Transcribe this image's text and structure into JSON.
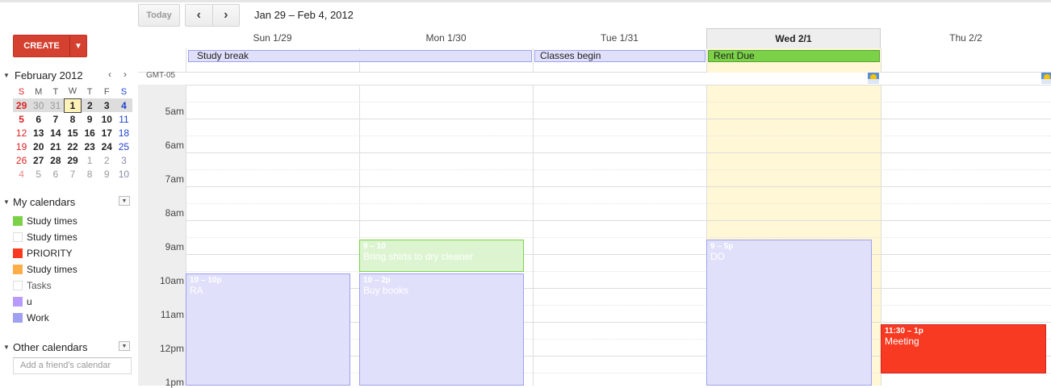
{
  "toolbar": {
    "today_label": "Today",
    "prev_icon": "‹",
    "next_icon": "›",
    "date_range": "Jan 29 – Feb 4, 2012"
  },
  "sidebar": {
    "create_label": "CREATE",
    "create_menu_icon": "▼",
    "mini_cal": {
      "title": "February 2012",
      "weekdays": [
        "S",
        "M",
        "T",
        "W",
        "T",
        "F",
        "S"
      ],
      "weeks": [
        [
          "29",
          "30",
          "31",
          "1",
          "2",
          "3",
          "4"
        ],
        [
          "5",
          "6",
          "7",
          "8",
          "9",
          "10",
          "11"
        ],
        [
          "12",
          "13",
          "14",
          "15",
          "16",
          "17",
          "18"
        ],
        [
          "19",
          "20",
          "21",
          "22",
          "23",
          "24",
          "25"
        ],
        [
          "26",
          "27",
          "28",
          "29",
          "1",
          "2",
          "3"
        ],
        [
          "4",
          "5",
          "6",
          "7",
          "8",
          "9",
          "10"
        ]
      ]
    },
    "my_calendars": {
      "title": "My calendars",
      "items": [
        {
          "label": "Study times",
          "color": "#7bd148"
        },
        {
          "label": "Study times",
          "color": "#ffffff"
        },
        {
          "label": "PRIORITY",
          "color": "#f83a22"
        },
        {
          "label": "Study times",
          "color": "#ffad46"
        },
        {
          "label": "Tasks",
          "color": "#ffffff"
        },
        {
          "label": "u",
          "color": "#b99aff"
        },
        {
          "label": "Work",
          "color": "#9fa0f0"
        }
      ]
    },
    "other_calendars": {
      "title": "Other calendars",
      "friend_placeholder": "Add a friend's calendar"
    }
  },
  "week": {
    "timezone": "GMT-05",
    "days": [
      "Sun 1/29",
      "Mon 1/30",
      "Tue 1/31",
      "Wed 2/1",
      "Thu 2/2"
    ],
    "hours": [
      "5am",
      "6am",
      "7am",
      "8am",
      "9am",
      "10am",
      "11am",
      "12pm",
      "1pm"
    ],
    "allday_events": [
      {
        "title": "Study break",
        "color": "#e0e0fa"
      },
      {
        "title": "Classes begin",
        "color": "#e0e0fa"
      },
      {
        "title": "Rent Due",
        "color": "#7bd148"
      }
    ],
    "events": [
      {
        "time": "9 – 10",
        "title": "Bring shirts to dry cleaner"
      },
      {
        "time": "10 – 10p",
        "title": "RA"
      },
      {
        "time": "10 – 2p",
        "title": "Buy books"
      },
      {
        "time": "9 – 5p",
        "title": "DO"
      },
      {
        "time": "11:30 – 1p",
        "title": "Meeting"
      }
    ]
  }
}
